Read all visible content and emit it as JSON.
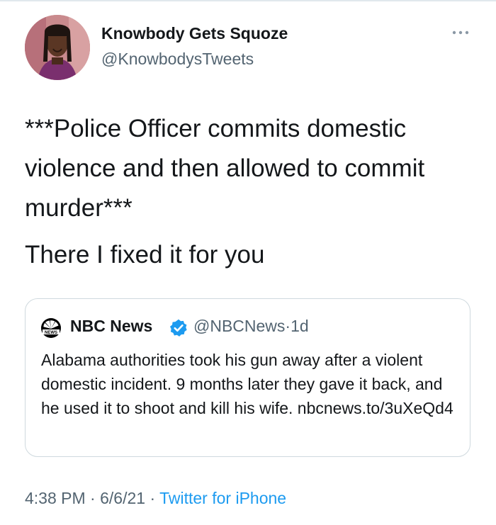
{
  "tweet": {
    "author_name": "Knowbody Gets Squoze",
    "author_handle": "@KnowbodysTweets",
    "text_paragraph_1": "***Police Officer commits domestic violence and then allowed to commit murder***",
    "text_paragraph_2": "There I fixed it for you",
    "time": "4:38 PM",
    "date": "6/6/21",
    "separator": "·",
    "source": "Twitter for iPhone",
    "more_icon": "more-horizontal-icon"
  },
  "quoted": {
    "author_name": "NBC News",
    "author_handle": "@NBCNews",
    "separator": "·",
    "age": "1d",
    "logo_text": "NEWS",
    "text": "Alabama authorities took his gun away after a violent domestic incident. 9 months later they gave it back, and he used it to shoot and kill his wife. nbcnews.to/3uXeQd4",
    "verified_icon": "verified-badge-icon",
    "logo_icon": "nbc-peacock-icon"
  },
  "colors": {
    "text_primary": "#14171a",
    "text_secondary": "#536471",
    "link": "#1d9bf0",
    "verified": "#1d9bf0",
    "border": "#cfd9de"
  }
}
